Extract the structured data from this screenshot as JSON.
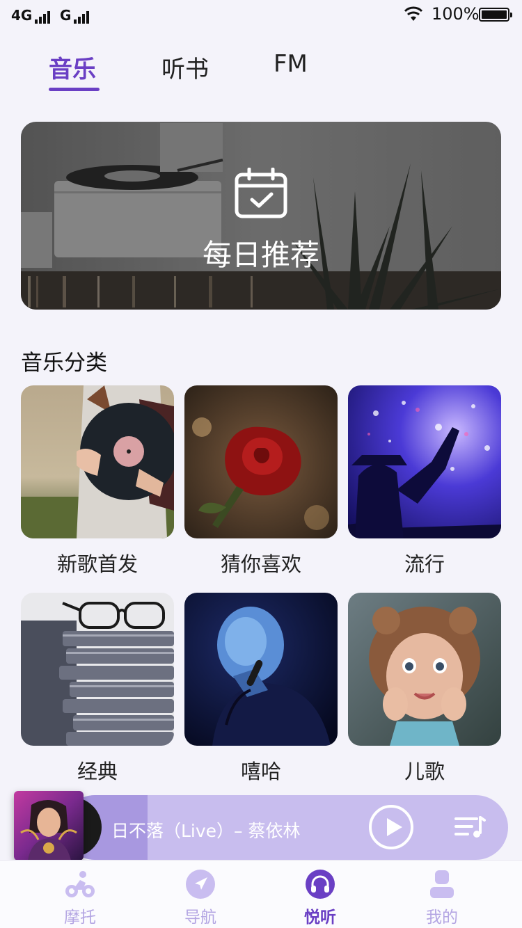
{
  "status": {
    "carrier1": "4G",
    "carrier2": "G",
    "battery": "100%"
  },
  "tabs": [
    {
      "label": "音乐",
      "active": true
    },
    {
      "label": "听书",
      "active": false
    },
    {
      "label": "FM",
      "active": false
    }
  ],
  "banner": {
    "title": "每日推荐",
    "icon": "calendar-check-icon"
  },
  "section": {
    "title": "音乐分类"
  },
  "categories": [
    {
      "label": "新歌首发"
    },
    {
      "label": "猜你喜欢"
    },
    {
      "label": "流行"
    },
    {
      "label": "经典"
    },
    {
      "label": "嘻哈"
    },
    {
      "label": "儿歌"
    }
  ],
  "player": {
    "track": "日不落（Live）– 蔡依林",
    "progress": 0.19
  },
  "nav": [
    {
      "label": "摩托",
      "icon": "motorcycle-icon"
    },
    {
      "label": "导航",
      "icon": "navigation-icon"
    },
    {
      "label": "悦听",
      "icon": "headphones-icon",
      "active": true
    },
    {
      "label": "我的",
      "icon": "user-icon"
    }
  ],
  "colors": {
    "accent": "#6a3fc4",
    "nav_inactive": "#b4a6e3",
    "player_bg": "#c8bdee"
  }
}
